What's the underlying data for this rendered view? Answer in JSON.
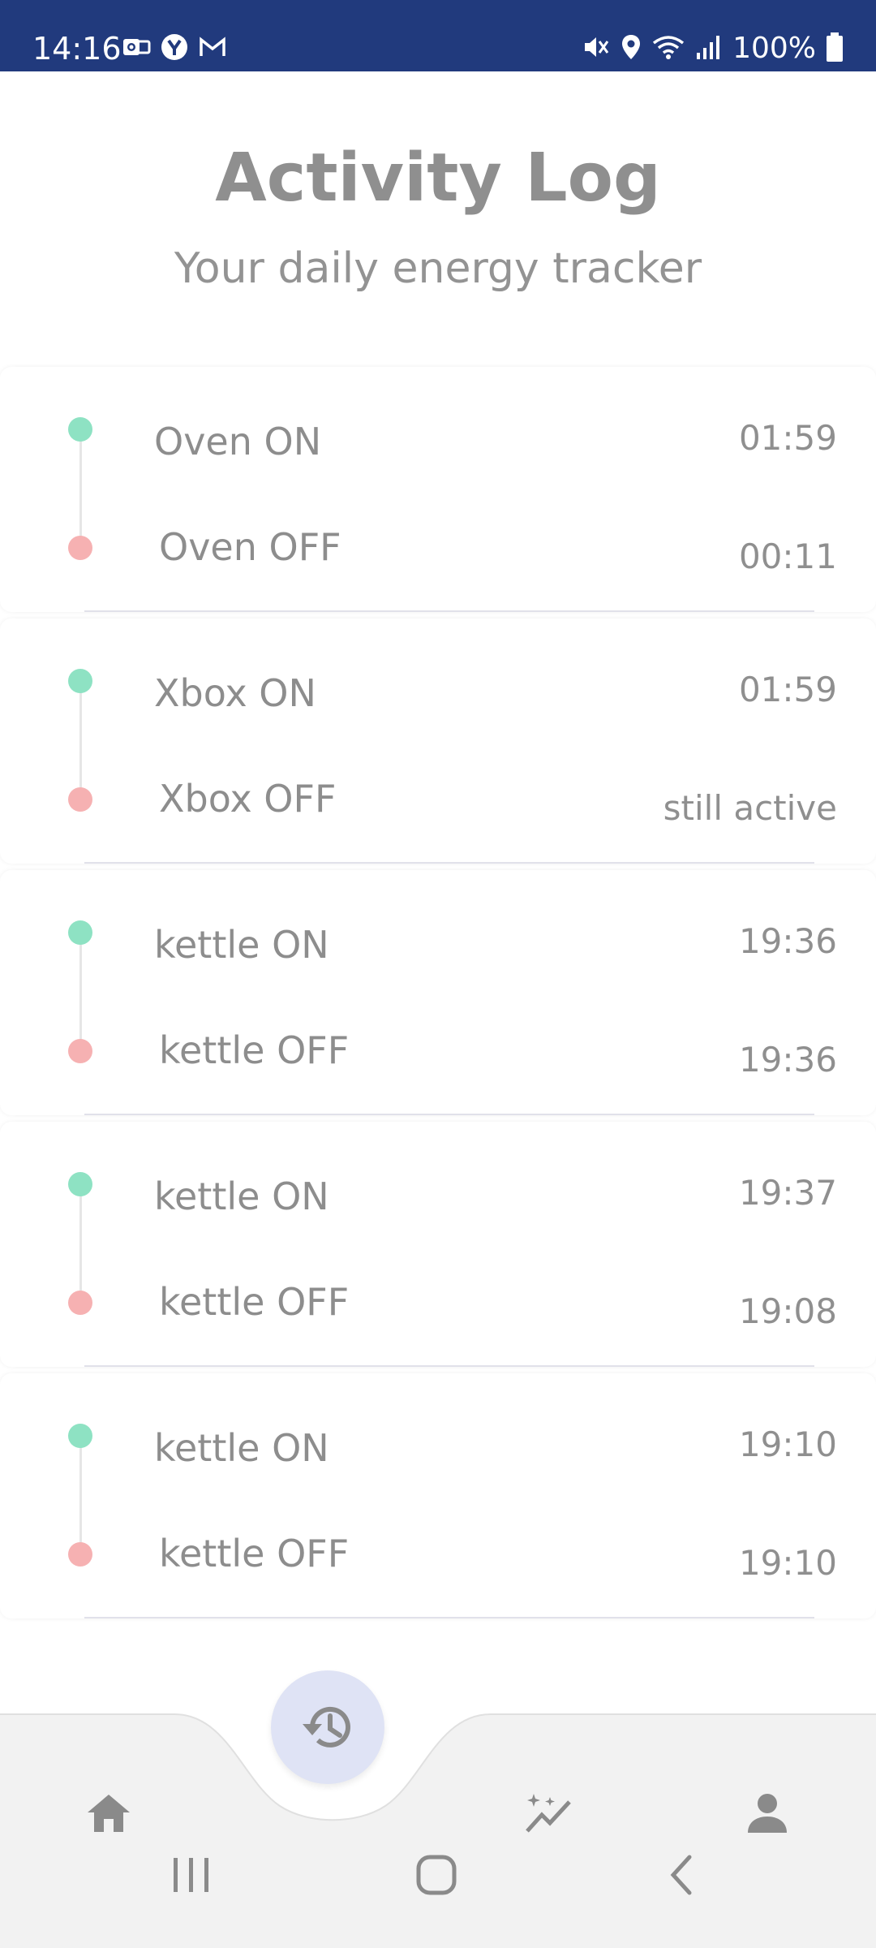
{
  "status_bar": {
    "time": "14:16",
    "battery": "100%",
    "left_icons": [
      "outlook-icon",
      "yahoo-icon",
      "gmail-icon"
    ],
    "right_icons": [
      "mute-icon",
      "location-icon",
      "wifi-icon",
      "signal-icon",
      "battery-icon"
    ],
    "background": "#213a7d"
  },
  "header": {
    "title": "Activity Log",
    "subtitle": "Your daily energy tracker"
  },
  "entries": [
    {
      "on_label": "Oven ON",
      "on_time": "01:59",
      "off_label": "Oven OFF",
      "off_time": "00:11"
    },
    {
      "on_label": "Xbox ON",
      "on_time": "01:59",
      "off_label": "Xbox OFF",
      "off_time": "still active"
    },
    {
      "on_label": "kettle ON",
      "on_time": "19:36",
      "off_label": "kettle OFF",
      "off_time": "19:36"
    },
    {
      "on_label": "kettle ON",
      "on_time": "19:37",
      "off_label": "kettle OFF",
      "off_time": "19:08"
    },
    {
      "on_label": "kettle ON",
      "on_time": "19:10",
      "off_label": "kettle OFF",
      "off_time": "19:10"
    }
  ],
  "colors": {
    "on_dot": "#8ee2c3",
    "off_dot": "#f6b1b2",
    "text_gray": "#8d8d8d",
    "fab_bg": "#dfe3f5"
  },
  "bottom_nav": {
    "items": [
      "home-icon",
      "history-icon",
      "insights-icon",
      "profile-icon"
    ],
    "active": "history-icon"
  },
  "system_nav": {
    "buttons": [
      "recents-icon",
      "home-circle-icon",
      "back-icon"
    ]
  }
}
